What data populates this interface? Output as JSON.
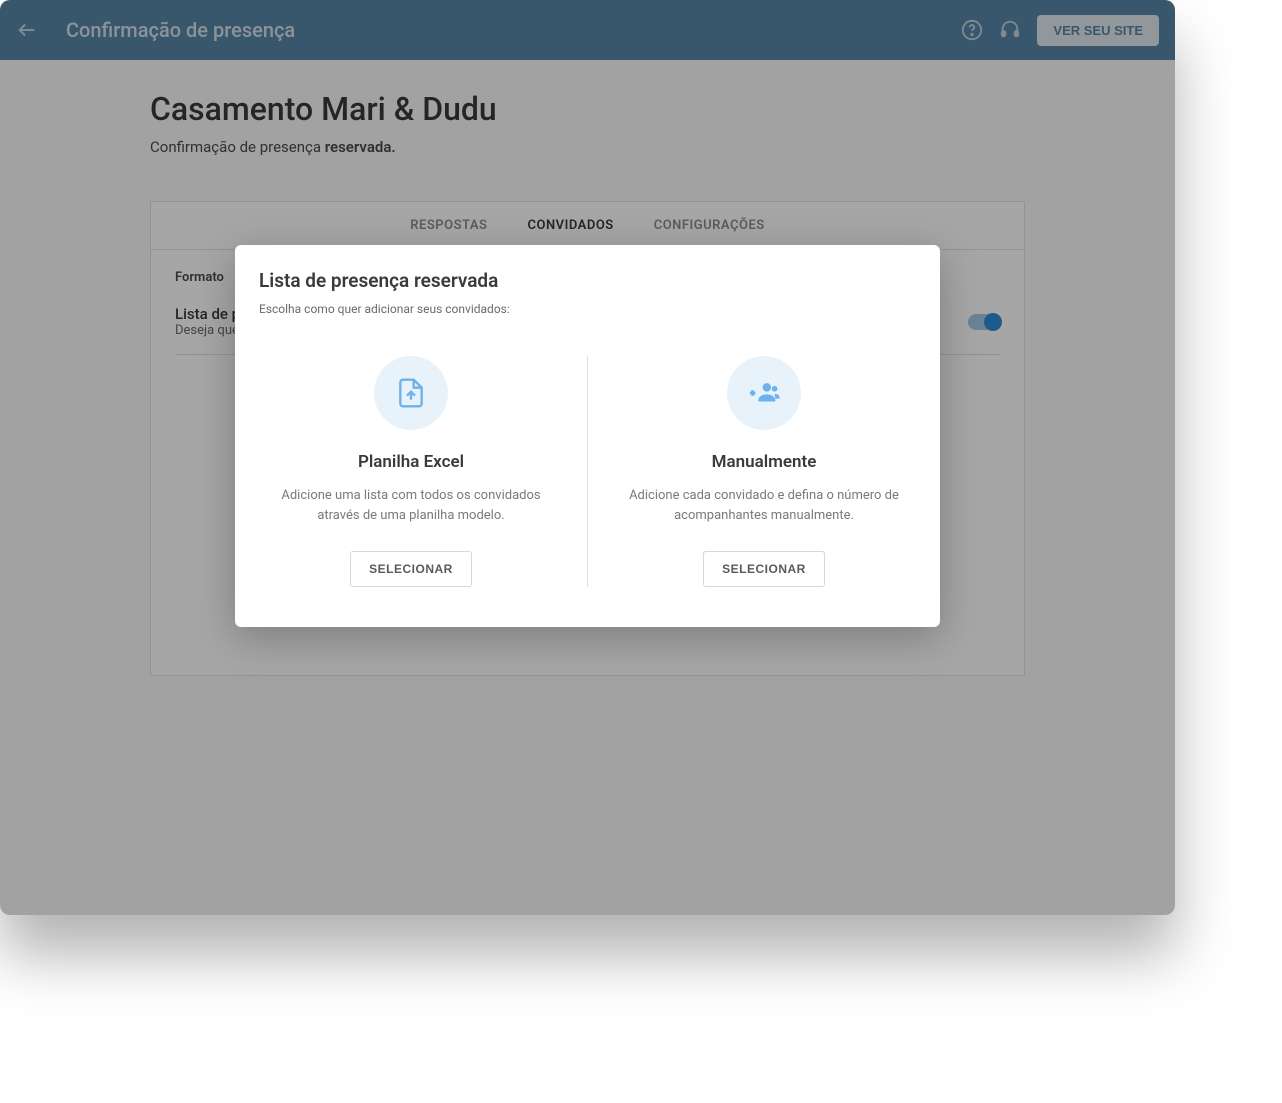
{
  "header": {
    "title": "Confirmação de presença",
    "view_site_label": "VER SEU SITE"
  },
  "page": {
    "title": "Casamento Mari & Dudu",
    "subtitle_prefix": "Confirmação de presença ",
    "subtitle_strong": "reservada."
  },
  "tabs": {
    "respostas": "RESPOSTAS",
    "convidados": "CONVIDADOS",
    "configuracoes": "CONFIGURAÇÕES"
  },
  "card": {
    "format_label": "Formato",
    "toggle_title": "Lista de p",
    "toggle_desc": "Deseja que"
  },
  "modal": {
    "title": "Lista de presença reservada",
    "subtitle": "Escolha como quer adicionar seus convidados:",
    "option_excel": {
      "title": "Planilha Excel",
      "desc": "Adicione uma lista com todos os convidados através de uma planilha modelo.",
      "button": "SELECIONAR"
    },
    "option_manual": {
      "title": "Manualmente",
      "desc": "Adicione cada convidado e defina o número de acompanhantes manualmente.",
      "button": "SELECIONAR"
    }
  }
}
